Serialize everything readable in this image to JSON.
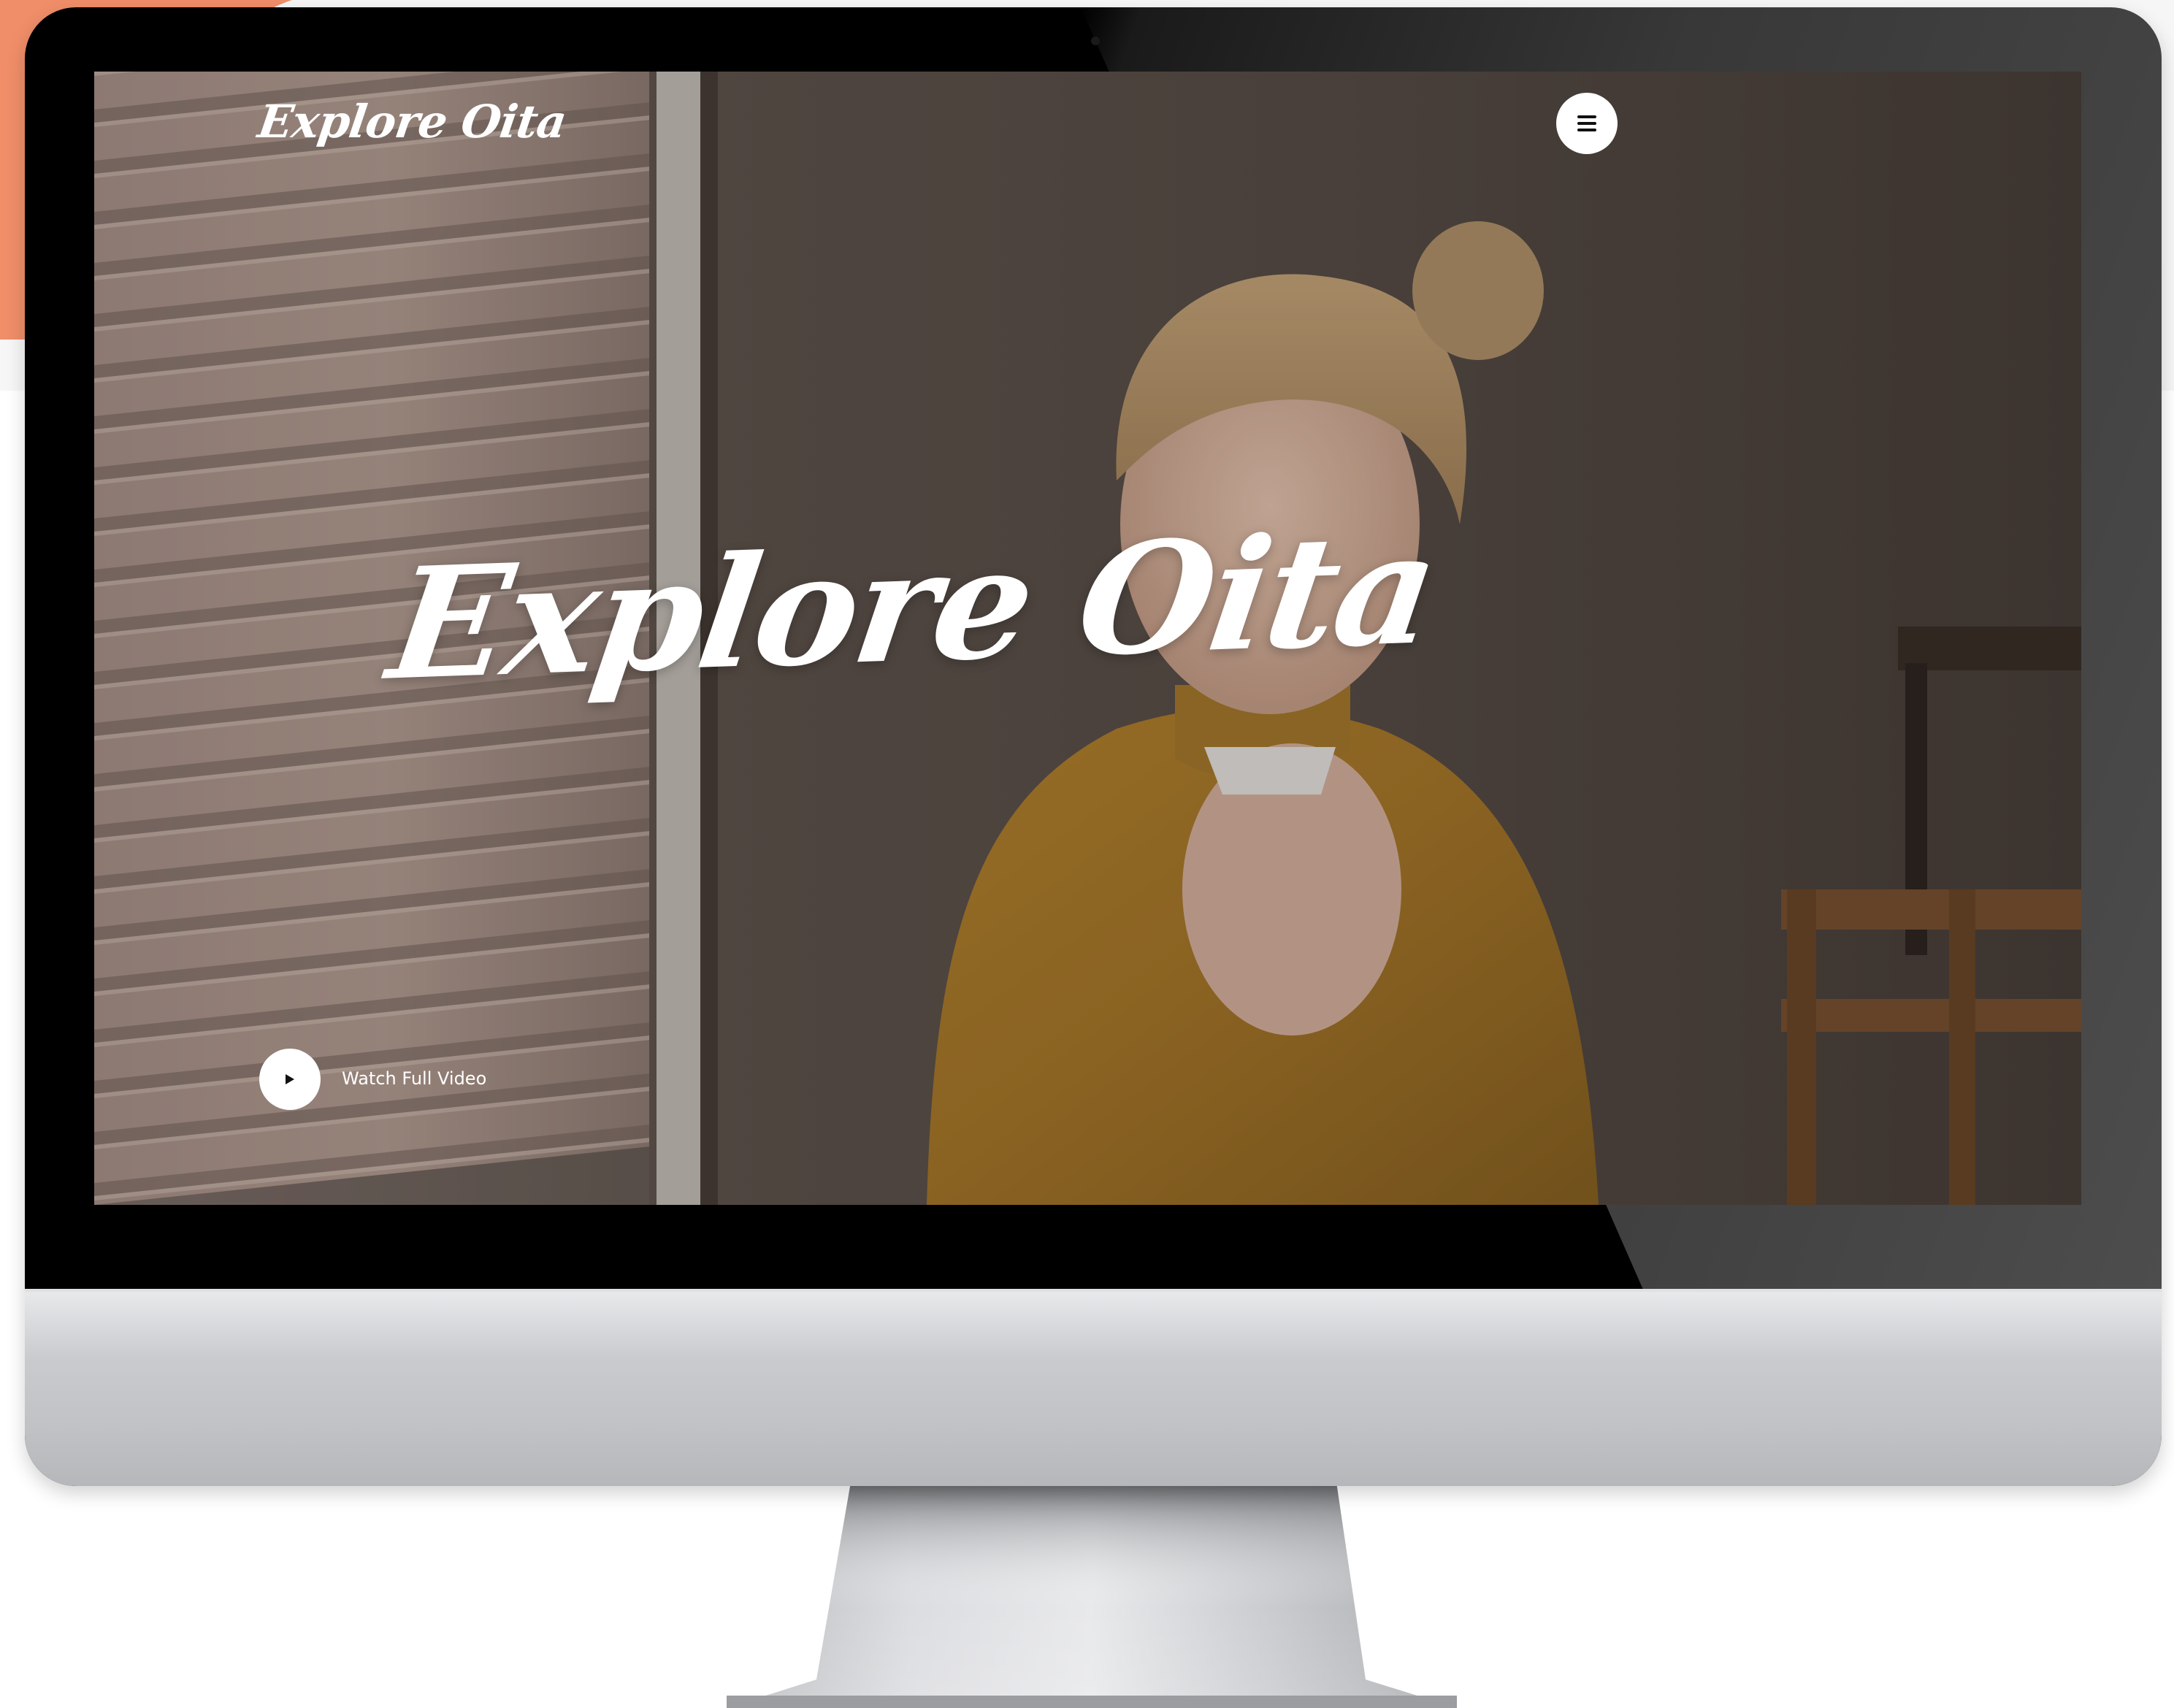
{
  "site": {
    "logo_text": "Explore Oita",
    "hero_title": "Explore Oita",
    "watch_video_label": "Watch Full Video"
  },
  "icons": {
    "menu": "hamburger-menu-icon",
    "play": "play-icon"
  },
  "colors": {
    "accent": "#f08e69",
    "text_on_photo": "#ffffff",
    "button_bg": "#ffffff",
    "icon": "#111111"
  }
}
